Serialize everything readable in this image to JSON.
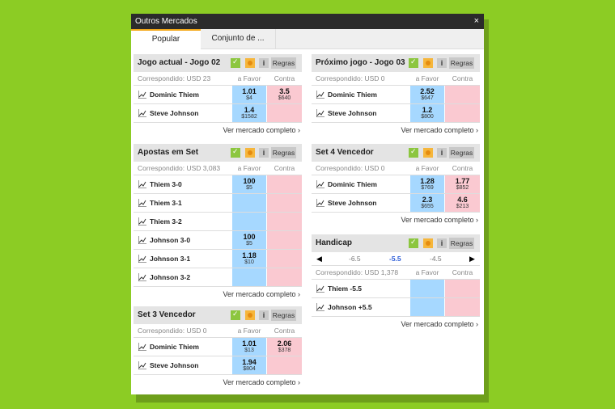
{
  "window": {
    "title": "Outros Mercados",
    "close": "×"
  },
  "tabs": [
    {
      "label": "Popular"
    },
    {
      "label": "Conjunto de ..."
    }
  ],
  "common": {
    "rules": "Regras",
    "info": "i",
    "back": "a Favor",
    "lay": "Contra",
    "more": "Ver mercado completo ›"
  },
  "markets": {
    "jogo_actual": {
      "title": "Jogo actual - Jogo 02",
      "matched": "Correspondido: USD 23",
      "runners": [
        {
          "name": "Dominic Thiem",
          "back": "1.01",
          "back_amt": "$4",
          "lay": "3.5",
          "lay_amt": "$640"
        },
        {
          "name": "Steve Johnson",
          "back": "1.4",
          "back_amt": "$1582",
          "lay": "",
          "lay_amt": ""
        }
      ]
    },
    "proximo_jogo": {
      "title": "Próximo jogo - Jogo 03",
      "matched": "Correspondido: USD 0",
      "runners": [
        {
          "name": "Dominic Thiem",
          "back": "2.52",
          "back_amt": "$647",
          "lay": "",
          "lay_amt": ""
        },
        {
          "name": "Steve Johnson",
          "back": "1.2",
          "back_amt": "$800",
          "lay": "",
          "lay_amt": ""
        }
      ]
    },
    "apostas_set": {
      "title": "Apostas em Set",
      "matched": "Correspondido: USD 3,083",
      "runners": [
        {
          "name": "Thiem 3-0",
          "back": "100",
          "back_amt": "$5"
        },
        {
          "name": "Thiem 3-1",
          "back": "",
          "back_amt": ""
        },
        {
          "name": "Thiem 3-2",
          "back": "",
          "back_amt": ""
        },
        {
          "name": "Johnson 3-0",
          "back": "100",
          "back_amt": "$5"
        },
        {
          "name": "Johnson 3-1",
          "back": "1.18",
          "back_amt": "$10"
        },
        {
          "name": "Johnson 3-2",
          "back": "",
          "back_amt": ""
        }
      ]
    },
    "set4": {
      "title": "Set 4 Vencedor",
      "matched": "Correspondido: USD 0",
      "runners": [
        {
          "name": "Dominic Thiem",
          "back": "1.28",
          "back_amt": "$769",
          "lay": "1.77",
          "lay_amt": "$852"
        },
        {
          "name": "Steve Johnson",
          "back": "2.3",
          "back_amt": "$655",
          "lay": "4.6",
          "lay_amt": "$213"
        }
      ]
    },
    "handicap": {
      "title": "Handicap",
      "lines": [
        "-6.5",
        "-5.5",
        "-4.5"
      ],
      "matched": "Correspondido: USD 1,378",
      "runners": [
        {
          "name": "Thiem -5.5"
        },
        {
          "name": "Johnson +5.5"
        }
      ]
    },
    "set3": {
      "title": "Set 3 Vencedor",
      "matched": "Correspondido: USD 0",
      "runners": [
        {
          "name": "Dominic Thiem",
          "back": "1.01",
          "back_amt": "$13",
          "lay": "2.06",
          "lay_amt": "$378"
        },
        {
          "name": "Steve Johnson",
          "back": "1.94",
          "back_amt": "$804",
          "lay": "",
          "lay_amt": ""
        }
      ]
    }
  }
}
